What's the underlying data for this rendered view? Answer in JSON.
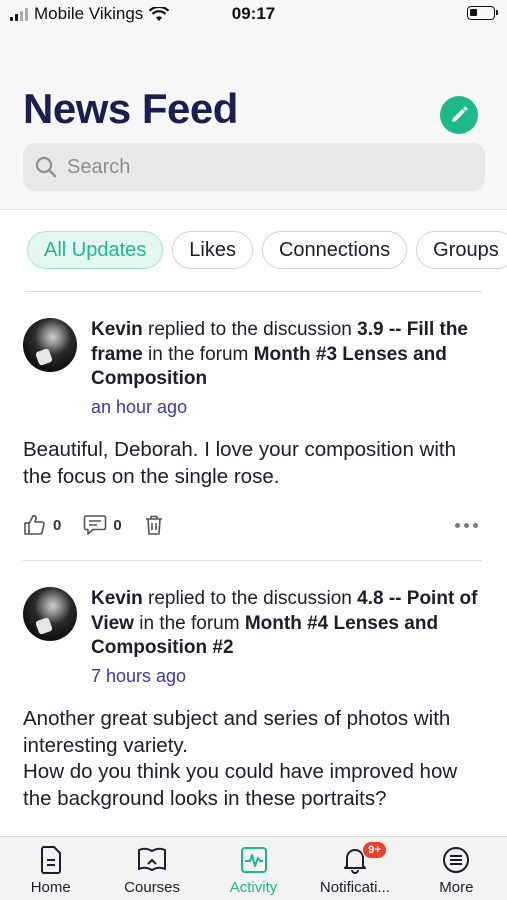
{
  "status_bar": {
    "carrier": "Mobile Vikings",
    "time": "09:17",
    "battery_level": 0.35
  },
  "header": {
    "title": "News Feed"
  },
  "search": {
    "placeholder": "Search"
  },
  "filters": [
    {
      "label": "All Updates",
      "active": true
    },
    {
      "label": "Likes",
      "active": false
    },
    {
      "label": "Connections",
      "active": false
    },
    {
      "label": "Groups",
      "active": false
    }
  ],
  "posts": [
    {
      "author": "Kevin",
      "action_text": " replied to the discussion ",
      "discussion": "3.9 -- Fill the frame",
      "forum_text": " in the forum ",
      "forum": "Month #3 Lenses and Composition",
      "time": "an hour ago",
      "body": "Beautiful, Deborah. I love your composition with the focus on the single rose.",
      "likes": "0",
      "comments": "0"
    },
    {
      "author": "Kevin",
      "action_text": " replied to the discussion ",
      "discussion": "4.8 -- Point of View",
      "forum_text": " in the forum ",
      "forum": "Month #4 Lenses and Composition #2",
      "time": "7 hours ago",
      "body": "Another great subject and series of photos with interesting variety.\nHow do you think you could have improved how the background looks in these portraits?",
      "likes": "0",
      "comments": "0"
    }
  ],
  "tabbar": {
    "items": [
      {
        "label": "Home",
        "icon": "document-icon"
      },
      {
        "label": "Courses",
        "icon": "book-icon"
      },
      {
        "label": "Activity",
        "icon": "activity-icon",
        "active": true
      },
      {
        "label": "Notificati...",
        "icon": "bell-icon",
        "badge": "9+"
      },
      {
        "label": "More",
        "icon": "menu-icon"
      }
    ]
  },
  "colors": {
    "accent": "#1fb889",
    "title": "#1f1d4d",
    "timestamp": "#3b3aa8",
    "badge": "#e8412c"
  }
}
